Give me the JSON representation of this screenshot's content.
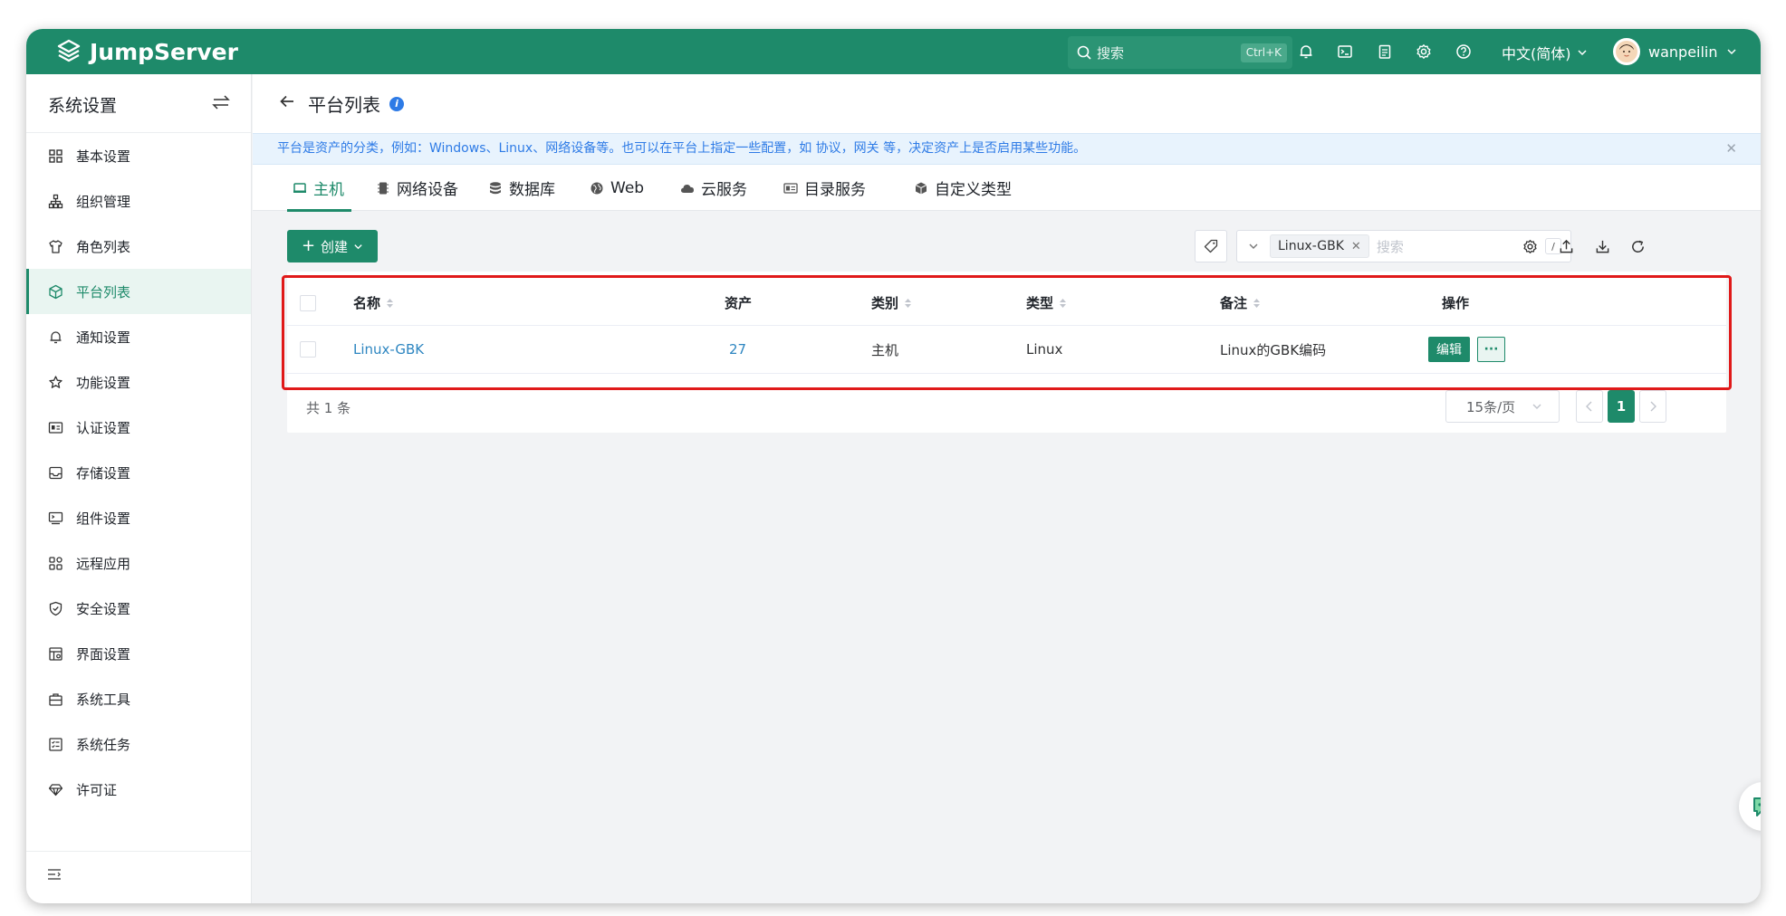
{
  "app": {
    "brand": "JumpServer"
  },
  "header": {
    "search_placeholder": "搜索",
    "search_shortcut": "Ctrl+K",
    "language": "中文(简体)",
    "username": "wanpeilin",
    "icons": [
      "bell-icon",
      "terminal-icon",
      "clipboard-icon",
      "gear-icon",
      "help-icon"
    ]
  },
  "sidebar": {
    "title": "系统设置",
    "items": [
      {
        "label": "基本设置",
        "icon": "grid-icon"
      },
      {
        "label": "组织管理",
        "icon": "org-tree-icon"
      },
      {
        "label": "角色列表",
        "icon": "shirt-icon"
      },
      {
        "label": "平台列表",
        "icon": "cube-icon",
        "active": true
      },
      {
        "label": "通知设置",
        "icon": "bell-icon"
      },
      {
        "label": "功能设置",
        "icon": "star-icon"
      },
      {
        "label": "认证设置",
        "icon": "id-card-icon"
      },
      {
        "label": "存储设置",
        "icon": "inbox-icon"
      },
      {
        "label": "组件设置",
        "icon": "monitor-icon"
      },
      {
        "label": "远程应用",
        "icon": "apps-icon"
      },
      {
        "label": "安全设置",
        "icon": "shield-icon"
      },
      {
        "label": "界面设置",
        "icon": "layout-icon"
      },
      {
        "label": "系统工具",
        "icon": "toolbox-icon"
      },
      {
        "label": "系统任务",
        "icon": "task-list-icon"
      },
      {
        "label": "许可证",
        "icon": "diamond-icon"
      }
    ]
  },
  "page": {
    "title": "平台列表",
    "notice": "平台是资产的分类，例如：Windows、Linux、网络设备等。也可以在平台上指定一些配置，如 协议，网关 等，决定资产上是否启用某些功能。",
    "tabs": [
      {
        "label": "主机",
        "icon": "host-icon",
        "active": true
      },
      {
        "label": "网络设备",
        "icon": "chip-icon"
      },
      {
        "label": "数据库",
        "icon": "database-icon"
      },
      {
        "label": "Web",
        "icon": "globe-icon"
      },
      {
        "label": "云服务",
        "icon": "cloud-icon"
      },
      {
        "label": "目录服务",
        "icon": "directory-icon"
      },
      {
        "label": "自定义类型",
        "icon": "box-icon"
      }
    ],
    "create_label": "创建",
    "filter": {
      "chip": "Linux-GBK",
      "placeholder": "搜索",
      "shortcut": "/"
    }
  },
  "table": {
    "columns": [
      "名称",
      "资产",
      "类别",
      "类型",
      "备注",
      "操作"
    ],
    "rows": [
      {
        "name": "Linux-GBK",
        "assets": "27",
        "category": "主机",
        "type": "Linux",
        "comment": "Linux的GBK编码",
        "edit_label": "编辑",
        "more_label": "···"
      }
    ],
    "total": "共 1 条",
    "page_size": "15条/页",
    "current_page": "1"
  },
  "colors": {
    "brand": "#1e8a6a",
    "link": "#2e86c1",
    "notice": "#2e7be6",
    "highlight": "#e01919"
  }
}
